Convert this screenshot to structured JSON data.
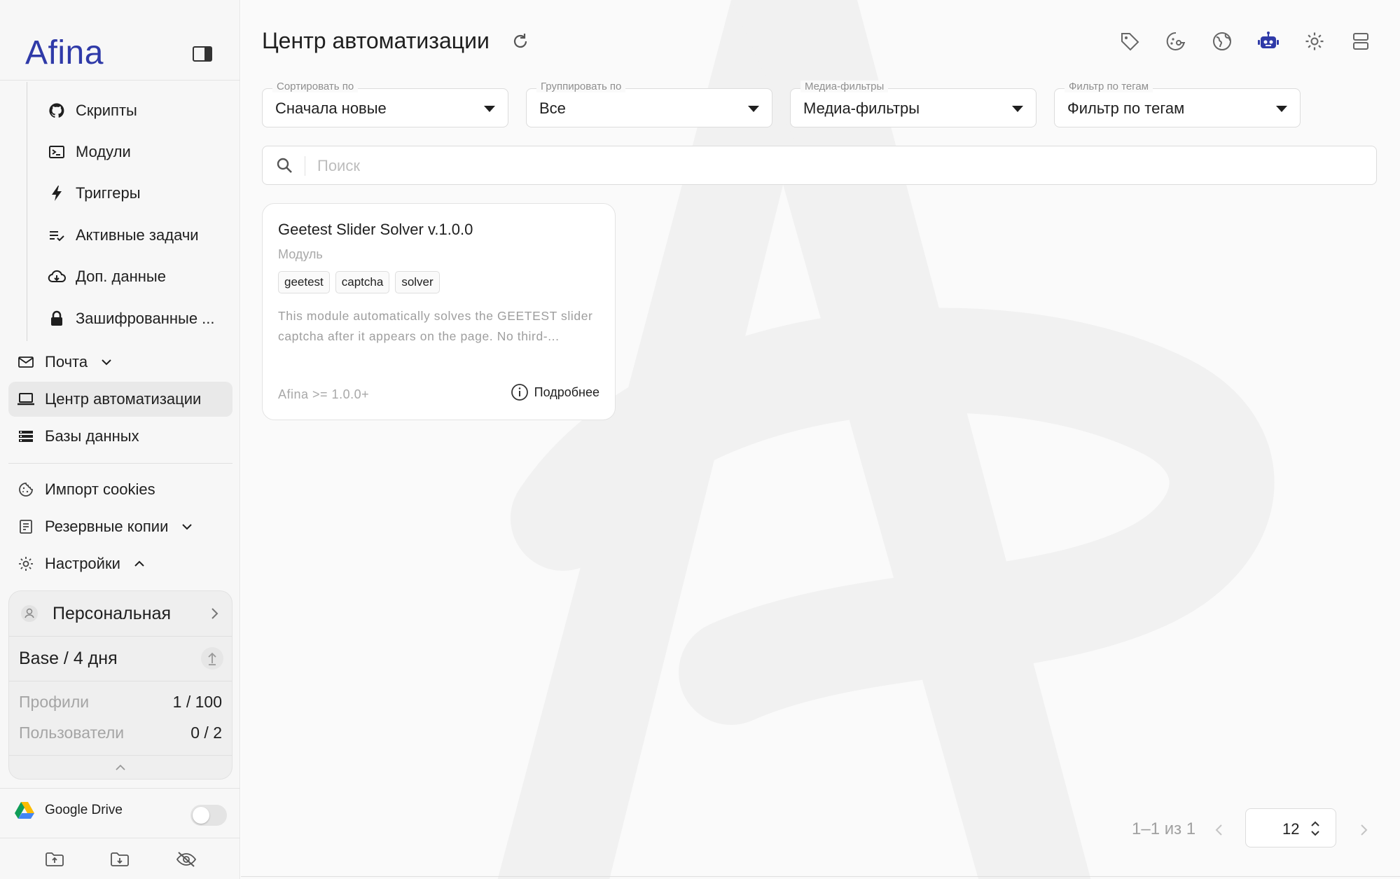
{
  "sidebar": {
    "logo": "Afina",
    "sub_items": [
      {
        "label": "Скрипты",
        "icon": "github-icon"
      },
      {
        "label": "Модули",
        "icon": "terminal-icon"
      },
      {
        "label": "Триггеры",
        "icon": "bolt-icon"
      },
      {
        "label": "Активные задачи",
        "icon": "task-list-icon"
      },
      {
        "label": "Доп. данные",
        "icon": "cloud-download-icon"
      },
      {
        "label": "Зашифрованные ...",
        "icon": "lock-icon"
      }
    ],
    "mail": {
      "label": "Почта",
      "icon": "mail-icon"
    },
    "automation": {
      "label": "Центр автоматизации",
      "icon": "laptop-icon"
    },
    "databases": {
      "label": "Базы данных",
      "icon": "database-list-icon"
    },
    "cookies": {
      "label": "Импорт cookies",
      "icon": "cookie-icon"
    },
    "backups": {
      "label": "Резервные копии",
      "icon": "backup-icon"
    },
    "settings": {
      "label": "Настройки",
      "icon": "gear-icon"
    },
    "plan": {
      "workspace": "Персональная",
      "tier": "Base / 4 дня",
      "profiles_label": "Профили",
      "profiles_value": "1 / 100",
      "users_label": "Пользователи",
      "users_value": "0 / 2"
    },
    "gdrive": {
      "label": "Google Drive",
      "enabled": false
    }
  },
  "main": {
    "title": "Центр автоматизации",
    "filters": [
      {
        "label": "Сортировать по",
        "value": "Сначала новые"
      },
      {
        "label": "Группировать по",
        "value": "Все"
      },
      {
        "label": "Медиа-фильтры",
        "value": "Медиа-фильтры"
      },
      {
        "label": "Фильтр по тегам",
        "value": "Фильтр по тегам"
      }
    ],
    "search_placeholder": "Поиск",
    "cards": [
      {
        "title": "Geetest Slider Solver v.1.0.0",
        "type": "Модуль",
        "tags": [
          "geetest",
          "captcha",
          "solver"
        ],
        "description": "This module automatically solves the GEETEST slider captcha after it appears on the page. No third-...",
        "version": "Afina >= 1.0.0+",
        "more_label": "Подробнее"
      }
    ],
    "pagination": {
      "range": "1–1 из 1",
      "per_page": "12"
    }
  },
  "colors": {
    "accent": "#2f3aa8",
    "active_bg": "#e9e9e9"
  }
}
